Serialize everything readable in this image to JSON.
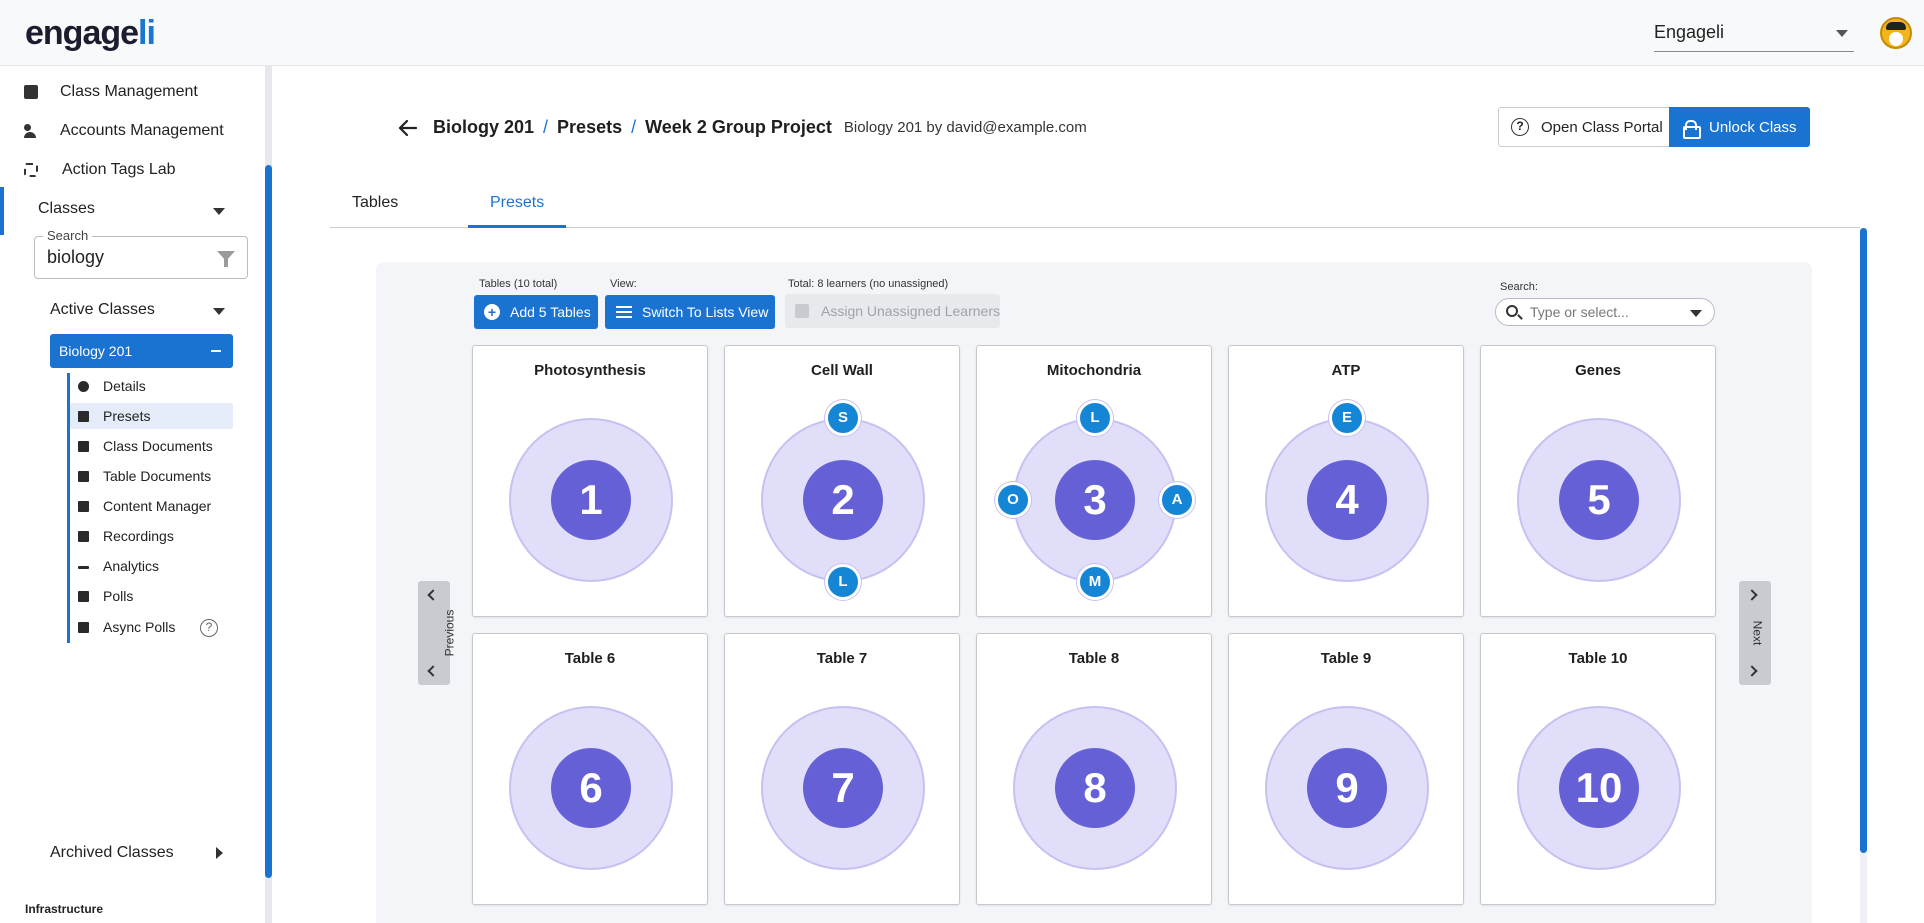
{
  "app": {
    "logo_main": "engage",
    "logo_accent": "li",
    "account_select": "Engageli"
  },
  "sidebar": {
    "nav": [
      {
        "label": "Class Management",
        "icon": "book-icon"
      },
      {
        "label": "Accounts Management",
        "icon": "people-icon"
      },
      {
        "label": "Action Tags Lab",
        "icon": "scan-icon"
      }
    ],
    "classes_label": "Classes",
    "search_legend": "Search",
    "search_value": "biology",
    "active_classes_label": "Active Classes",
    "selected_class": "Biology 201",
    "sub_items": [
      {
        "label": "Details",
        "icon": "info-icon"
      },
      {
        "label": "Presets",
        "icon": "presets-icon"
      },
      {
        "label": "Class Documents",
        "icon": "documents-icon"
      },
      {
        "label": "Table Documents",
        "icon": "document-icon"
      },
      {
        "label": "Content Manager",
        "icon": "image-icon"
      },
      {
        "label": "Recordings",
        "icon": "film-icon"
      },
      {
        "label": "Analytics",
        "icon": "chart-icon"
      },
      {
        "label": "Polls",
        "icon": "poll-icon"
      },
      {
        "label": "Async Polls",
        "icon": "poll-icon"
      }
    ],
    "help_glyph": "?",
    "archived_label": "Archived Classes",
    "footer": "Infrastructure"
  },
  "header": {
    "crumbs": [
      "Biology 201",
      "Presets",
      "Week 2 Group Project"
    ],
    "separator": "/",
    "byline": "Biology 201 by david@example.com",
    "open_portal": "Open Class Portal",
    "portal_glyph": "?",
    "unlock": "Unlock Class"
  },
  "tabs": [
    "Tables",
    "Presets"
  ],
  "toolbar": {
    "tables_label": "Tables (10 total)",
    "add_tables": "Add 5 Tables",
    "view_label": "View:",
    "switch_view": "Switch To Lists View",
    "total_label": "Total: 8 learners (no unassigned)",
    "assign": "Assign Unassigned Learners",
    "search_label": "Search:",
    "search_placeholder": "Type or select..."
  },
  "pager": {
    "previous": "Previous",
    "next": "Next"
  },
  "tables": [
    {
      "title": "Photosynthesis",
      "number": "1",
      "seats": []
    },
    {
      "title": "Cell Wall",
      "number": "2",
      "seats": [
        {
          "pos": "top",
          "letter": "S"
        },
        {
          "pos": "bottom",
          "letter": "L"
        }
      ]
    },
    {
      "title": "Mitochondria",
      "number": "3",
      "seats": [
        {
          "pos": "top",
          "letter": "L"
        },
        {
          "pos": "left",
          "letter": "O"
        },
        {
          "pos": "right",
          "letter": "A"
        },
        {
          "pos": "bottom",
          "letter": "M"
        }
      ]
    },
    {
      "title": "ATP",
      "number": "4",
      "seats": [
        {
          "pos": "top",
          "letter": "E"
        }
      ]
    },
    {
      "title": "Genes",
      "number": "5",
      "seats": []
    },
    {
      "title": "Table 6",
      "number": "6",
      "seats": []
    },
    {
      "title": "Table 7",
      "number": "7",
      "seats": []
    },
    {
      "title": "Table 8",
      "number": "8",
      "seats": []
    },
    {
      "title": "Table 9",
      "number": "9",
      "seats": []
    },
    {
      "title": "Table 10",
      "number": "10",
      "seats": []
    }
  ],
  "colors": {
    "accent": "#1a73d1",
    "table_core": "#6560d5",
    "table_ring": "#e1defa",
    "seat": "#1585d6"
  }
}
